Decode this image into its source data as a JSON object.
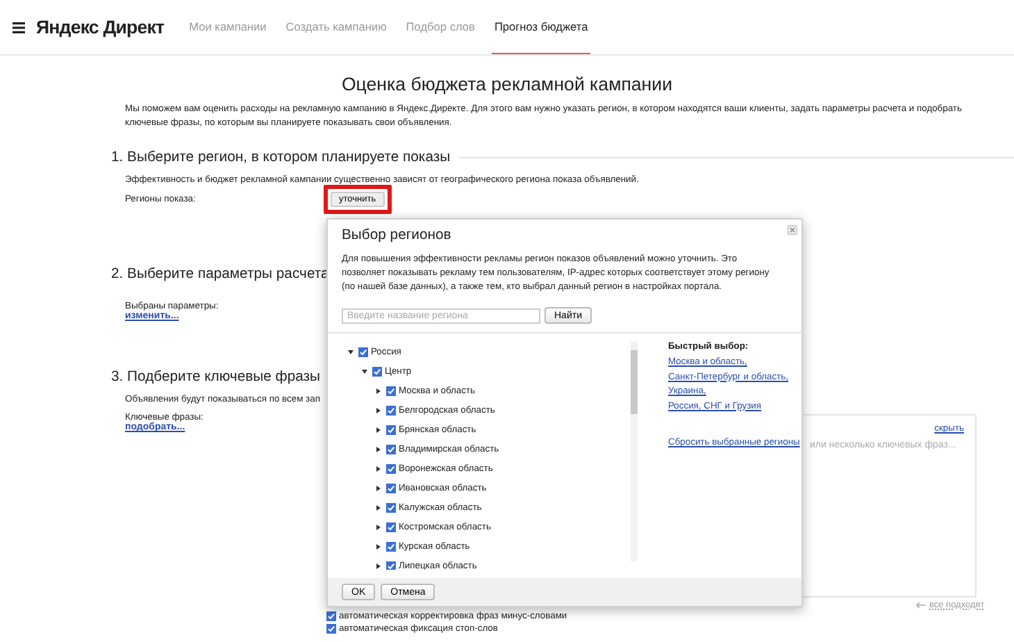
{
  "header": {
    "logo": "Яндекс Директ",
    "nav": [
      {
        "label": "Мои кампании",
        "selected": false
      },
      {
        "label": "Создать кампанию",
        "selected": false
      },
      {
        "label": "Подбор слов",
        "selected": false
      },
      {
        "label": "Прогноз бюджета",
        "selected": true
      }
    ]
  },
  "title": "Оценка бюджета рекламной кампании",
  "intro": "Мы поможем вам оценить расходы на рекламную кампанию в Яндекс.Директе. Для этого вам нужно указать регион, в котором находятся ваши клиенты, задать параметры расчета и подобрать ключевые фразы, по которым вы планируете показывать свои объявления.",
  "section_1": {
    "heading": "1. Выберите регион, в котором планируете показы",
    "description": "Эффективность и бюджет рекламной кампании существенно зависят от географического региона показа объявлений.",
    "label": "Регионы показа:",
    "button": {
      "label": "уточнить",
      "highlighted": true
    }
  },
  "section_2": {
    "heading": "2. Выберите параметры расчета",
    "label": "Выбраны параметры:",
    "link": "изменить..."
  },
  "section_3": {
    "heading": "3. Подберите ключевые фразы",
    "description": "Объявления будут показываться по всем зап",
    "label": "Ключевые фразы:",
    "link": "подобрать...",
    "keywords_panel": {
      "hide_link": "скрыть",
      "placeholder": "или несколько ключевых фраз...",
      "hint": "все подходят"
    },
    "options": [
      {
        "label": "автоматическая корректировка фраз минус-словами",
        "checked": true
      },
      {
        "label": "автоматическая фиксация стоп-слов",
        "checked": true
      }
    ]
  },
  "dialog": {
    "title": "Выбор регионов",
    "description": "Для повышения эффективности рекламы регион показов объявлений можно уточнить. Это позволяет показывать рекламу тем пользователям, IP-адрес которых соответствует этому региону (по нашей базе данных), а также тем, кто выбрал данный регион в настройках портала.",
    "search": {
      "placeholder": "Введите название региона",
      "button": "Найти"
    },
    "tree": [
      {
        "label": "Россия",
        "checked": true,
        "expanded": true,
        "children": [
          {
            "label": "Центр",
            "checked": true,
            "expanded": true,
            "children": [
              {
                "label": "Москва и область",
                "checked": true,
                "expanded": false
              },
              {
                "label": "Белгородская область",
                "checked": true,
                "expanded": false
              },
              {
                "label": "Брянская область",
                "checked": true,
                "expanded": false
              },
              {
                "label": "Владимирская область",
                "checked": true,
                "expanded": false
              },
              {
                "label": "Воронежская область",
                "checked": true,
                "expanded": false
              },
              {
                "label": "Ивановская область",
                "checked": true,
                "expanded": false
              },
              {
                "label": "Калужская область",
                "checked": true,
                "expanded": false
              },
              {
                "label": "Костромская область",
                "checked": true,
                "expanded": false
              },
              {
                "label": "Курская область",
                "checked": true,
                "expanded": false
              },
              {
                "label": "Липецкая область",
                "checked": true,
                "expanded": false
              }
            ]
          }
        ]
      }
    ],
    "quick_select": {
      "title": "Быстрый выбор:",
      "links": [
        "Москва и область,",
        "Санкт-Петербург и область,",
        "Украина,",
        "Россия, СНГ и Грузия"
      ]
    },
    "reset_link": "Сбросить выбранные регионы",
    "buttons": [
      "OK",
      "Отмена"
    ]
  }
}
